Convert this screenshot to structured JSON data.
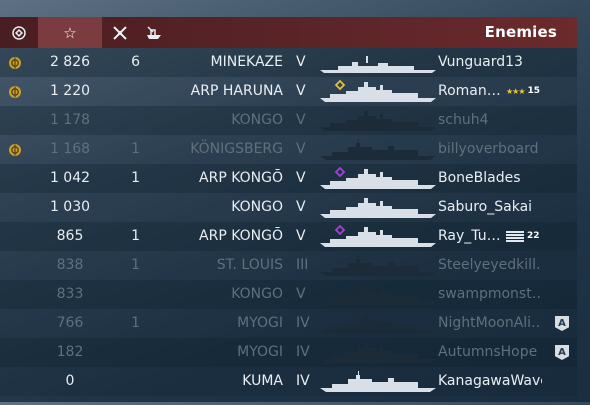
{
  "header": {
    "title": "Enemies",
    "icons": [
      "clan-emblem-icon",
      "star-score-icon",
      "frags-icon",
      "ship-icon"
    ]
  },
  "rows": [
    {
      "emblem": true,
      "score": "2 826",
      "frags": "6",
      "ship": "MINEKAZE",
      "tier": "V",
      "player": "Vunguard13",
      "dim": false,
      "rank": null,
      "badge": null,
      "sil": "destroyer",
      "mark": null
    },
    {
      "emblem": true,
      "score": "1 220",
      "frags": "",
      "ship": "ARP HARUNA",
      "tier": "V",
      "player": "Roman…",
      "dim": false,
      "rank": {
        "type": "stars",
        "value": "15"
      },
      "badge": null,
      "sil": "battleship",
      "mark": "yellow"
    },
    {
      "emblem": false,
      "score": "1 178",
      "frags": "",
      "ship": "KONGO",
      "tier": "V",
      "player": "schuh4",
      "dim": true,
      "rank": null,
      "badge": null,
      "sil": "battleship",
      "mark": null
    },
    {
      "emblem": true,
      "score": "1 168",
      "frags": "1",
      "ship": "KÖNIGSBERG",
      "tier": "V",
      "player": "billyoverboard",
      "dim": true,
      "rank": null,
      "badge": null,
      "sil": "cruiser",
      "mark": null
    },
    {
      "emblem": false,
      "score": "1 042",
      "frags": "1",
      "ship": "ARP KONGŌ",
      "tier": "V",
      "player": "BoneBlades",
      "dim": false,
      "rank": null,
      "badge": null,
      "sil": "battleship",
      "mark": "purple"
    },
    {
      "emblem": false,
      "score": "1 030",
      "frags": "",
      "ship": "KONGO",
      "tier": "V",
      "player": "Saburo_Sakai",
      "dim": false,
      "rank": null,
      "badge": null,
      "sil": "battleship",
      "mark": null
    },
    {
      "emblem": false,
      "score": "865",
      "frags": "1",
      "ship": "ARP KONGŌ",
      "tier": "V",
      "player": "Ray_Tu…",
      "dim": false,
      "rank": {
        "type": "stripes",
        "value": "22"
      },
      "badge": null,
      "sil": "battleship",
      "mark": "purple"
    },
    {
      "emblem": false,
      "score": "838",
      "frags": "1",
      "ship": "ST. LOUIS",
      "tier": "III",
      "player": "Steelyeyedkill…",
      "dim": true,
      "rank": null,
      "badge": null,
      "sil": "cruiser",
      "mark": null
    },
    {
      "emblem": false,
      "score": "833",
      "frags": "",
      "ship": "KONGO",
      "tier": "V",
      "player": "swampmonst…",
      "dim": true,
      "rank": null,
      "badge": null,
      "sil": "battleship",
      "mark": null
    },
    {
      "emblem": false,
      "score": "766",
      "frags": "1",
      "ship": "MYOGI",
      "tier": "IV",
      "player": "NightMoonAli…",
      "dim": true,
      "rank": null,
      "badge": "A",
      "sil": "battleship",
      "mark": null
    },
    {
      "emblem": false,
      "score": "182",
      "frags": "",
      "ship": "MYOGI",
      "tier": "IV",
      "player": "AutumnsHope",
      "dim": true,
      "rank": null,
      "badge": "A",
      "sil": "battleship",
      "mark": null
    },
    {
      "emblem": false,
      "score": "0",
      "frags": "",
      "ship": "KUMA",
      "tier": "IV",
      "player": "KanagawaWave",
      "dim": false,
      "rank": null,
      "badge": null,
      "sil": "cruiser",
      "mark": null
    }
  ],
  "colors": {
    "header": "#5a2427",
    "header_selected": "#7a3c3e",
    "alive_text": "#e8eef2",
    "dead_text": "#5f6f7c",
    "emblem": "#c9a02c",
    "rank_stars": "#f4c430",
    "mark_yellow": "#e0c23a",
    "mark_purple": "#a640d8"
  }
}
